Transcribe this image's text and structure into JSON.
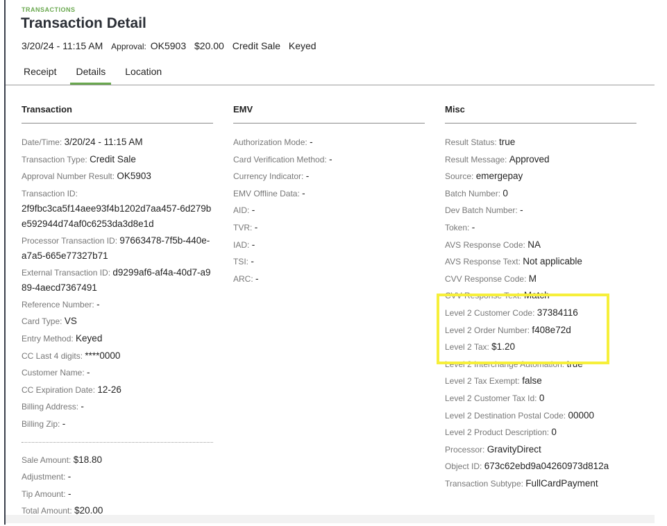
{
  "header": {
    "eyebrow": "TRANSACTIONS",
    "title": "Transaction Detail",
    "datetime": "3/20/24 - 11:15 AM",
    "approval_label": "Approval:",
    "approval_code": "OK5903",
    "amount": "$20.00",
    "type": "Credit Sale",
    "entry": "Keyed"
  },
  "tabs": [
    {
      "label": "Receipt",
      "active": false
    },
    {
      "label": "Details",
      "active": true
    },
    {
      "label": "Location",
      "active": false
    }
  ],
  "accent_color": "#6aa84f",
  "highlight_color": "#f6ef3a",
  "transaction": {
    "heading": "Transaction",
    "rows": [
      {
        "label": "Date/Time:",
        "value": "3/20/24 - 11:15 AM"
      },
      {
        "label": "Transaction Type:",
        "value": "Credit Sale"
      },
      {
        "label": "Approval Number Result:",
        "value": "OK5903"
      },
      {
        "label": "Transaction ID:",
        "value": "2f9fbc3ca5f14aee93f4b1202d7aa457-6d279be592944d74af0c6253da3d8e1d"
      },
      {
        "label": "Processor Transaction ID:",
        "value": "97663478-7f5b-440e-a7a5-665e77327b71"
      },
      {
        "label": "External Transaction ID:",
        "value": "d9299af6-af4a-40d7-a989-4aecd7367491"
      },
      {
        "label": "Reference Number:",
        "value": "-"
      },
      {
        "label": "Card Type:",
        "value": "VS"
      },
      {
        "label": "Entry Method:",
        "value": "Keyed"
      },
      {
        "label": "CC Last 4 digits:",
        "value": "****0000"
      },
      {
        "label": "Customer Name:",
        "value": "-"
      },
      {
        "label": "CC Expiration Date:",
        "value": "12-26"
      },
      {
        "label": "Billing Address:",
        "value": "-"
      },
      {
        "label": "Billing Zip:",
        "value": "-"
      }
    ],
    "amounts": [
      {
        "label": "Sale Amount:",
        "value": "$18.80"
      },
      {
        "label": "Adjustment:",
        "value": "-"
      },
      {
        "label": "Tip Amount:",
        "value": "-"
      },
      {
        "label": "Total Amount:",
        "value": "$20.00"
      }
    ]
  },
  "emv": {
    "heading": "EMV",
    "rows": [
      {
        "label": "Authorization Mode:",
        "value": "-"
      },
      {
        "label": "Card Verification Method:",
        "value": "-"
      },
      {
        "label": "Currency Indicator:",
        "value": "-"
      },
      {
        "label": "EMV Offline Data:",
        "value": "-"
      },
      {
        "label": "AID:",
        "value": "-"
      },
      {
        "label": "TVR:",
        "value": "-"
      },
      {
        "label": "IAD:",
        "value": "-"
      },
      {
        "label": "TSI:",
        "value": "-"
      },
      {
        "label": "ARC:",
        "value": "-"
      }
    ]
  },
  "misc": {
    "heading": "Misc",
    "rows": [
      {
        "label": "Result Status:",
        "value": "true"
      },
      {
        "label": "Result Message:",
        "value": "Approved"
      },
      {
        "label": "Source:",
        "value": "emergepay"
      },
      {
        "label": "Batch Number:",
        "value": "0"
      },
      {
        "label": "Dev Batch Number:",
        "value": "-"
      },
      {
        "label": "Token:",
        "value": "-"
      },
      {
        "label": "AVS Response Code:",
        "value": "NA"
      },
      {
        "label": "AVS Response Text:",
        "value": "Not applicable"
      },
      {
        "label": "CVV Response Code:",
        "value": "M"
      },
      {
        "label": "CVV Response Text:",
        "value": "Match"
      },
      {
        "label": "Level 2 Customer Code:",
        "value": "37384116"
      },
      {
        "label": "Level 2 Order Number:",
        "value": "f408e72d"
      },
      {
        "label": "Level 2 Tax:",
        "value": "$1.20"
      },
      {
        "label": "Level 2 Interchange Automation:",
        "value": "true"
      },
      {
        "label": "Level 2 Tax Exempt:",
        "value": "false"
      },
      {
        "label": "Level 2 Customer Tax Id:",
        "value": "0"
      },
      {
        "label": "Level 2 Destination Postal Code:",
        "value": "00000"
      },
      {
        "label": "Level 2 Product Description:",
        "value": "0"
      },
      {
        "label": "Processor:",
        "value": "GravityDirect"
      },
      {
        "label": "Object ID:",
        "value": "673c62ebd9a04260973d812a"
      },
      {
        "label": "Transaction Subtype:",
        "value": "FullCardPayment"
      }
    ]
  }
}
